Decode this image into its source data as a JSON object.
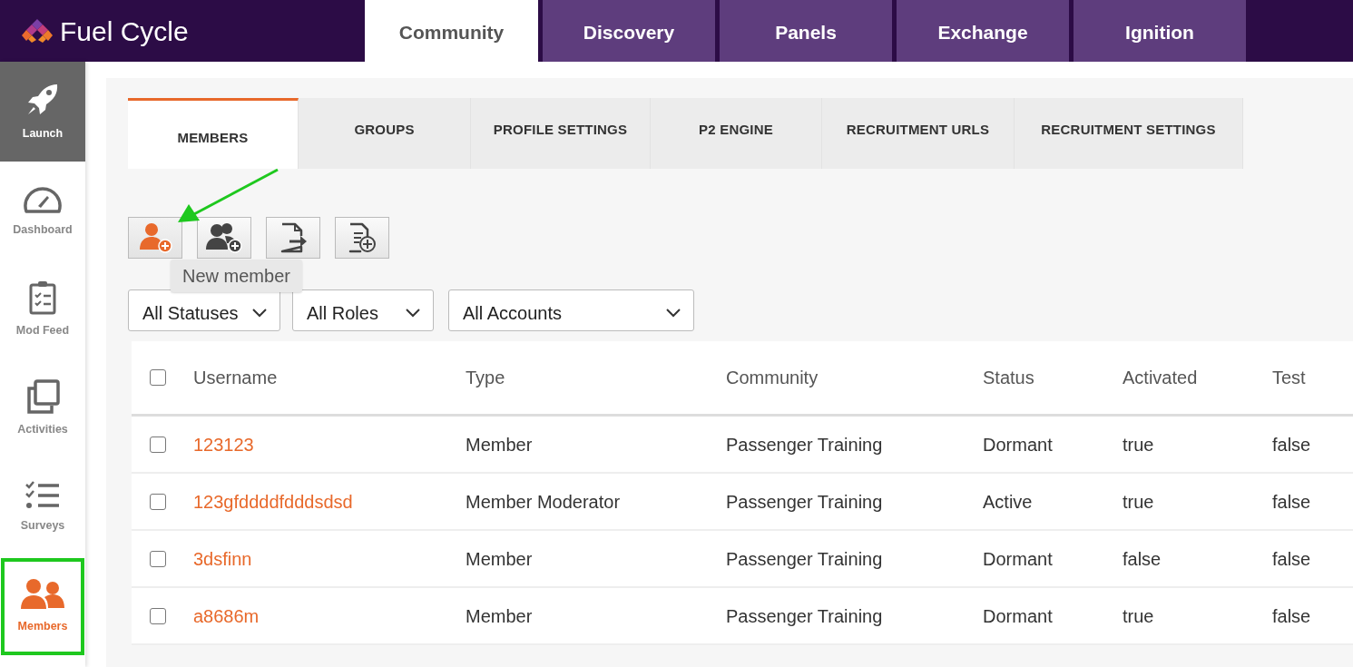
{
  "brand": {
    "name": "Fuel Cycle"
  },
  "top_tabs": [
    {
      "label": "Community",
      "selected": true
    },
    {
      "label": "Discovery",
      "selected": false
    },
    {
      "label": "Panels",
      "selected": false
    },
    {
      "label": "Exchange",
      "selected": false
    },
    {
      "label": "Ignition",
      "selected": false
    }
  ],
  "sidebar": {
    "items": [
      {
        "label": "Launch",
        "kind": "launch",
        "selected": false,
        "highlighted": false
      },
      {
        "label": "Dashboard",
        "kind": "dashboard",
        "selected": false,
        "highlighted": false
      },
      {
        "label": "Mod Feed",
        "kind": "modfeed",
        "selected": false,
        "highlighted": false
      },
      {
        "label": "Activities",
        "kind": "activities",
        "selected": false,
        "highlighted": false
      },
      {
        "label": "Surveys",
        "kind": "surveys",
        "selected": false,
        "highlighted": false
      },
      {
        "label": "Members",
        "kind": "members",
        "selected": true,
        "highlighted": true
      }
    ]
  },
  "sub_tabs": [
    {
      "label": "MEMBERS",
      "selected": true
    },
    {
      "label": "GROUPS",
      "selected": false
    },
    {
      "label": "PROFILE SETTINGS",
      "selected": false
    },
    {
      "label": "P2 ENGINE",
      "selected": false
    },
    {
      "label": "RECRUITMENT URLS",
      "selected": false
    },
    {
      "label": "RECRUITMENT SETTINGS",
      "selected": false
    }
  ],
  "toolbar": [
    {
      "kind": "new-member",
      "active": true
    },
    {
      "kind": "import-members",
      "active": false
    },
    {
      "kind": "export",
      "active": false
    },
    {
      "kind": "add-document",
      "active": false
    }
  ],
  "tooltip": "New member",
  "filters": [
    {
      "value": "All Statuses"
    },
    {
      "value": "All Roles"
    },
    {
      "value": "All Accounts"
    }
  ],
  "table": {
    "all_checked": false,
    "columns": [
      "Username",
      "Type",
      "Community",
      "Status",
      "Activated",
      "Test"
    ],
    "rows": [
      {
        "checked": false,
        "cells": [
          "123123",
          "Member",
          "Passenger Training",
          "Dormant",
          "true",
          "false"
        ]
      },
      {
        "checked": false,
        "cells": [
          "123gfddddfdddsdsd",
          "Member Moderator",
          "Passenger Training",
          "Active",
          "true",
          "false"
        ]
      },
      {
        "checked": false,
        "cells": [
          "3dsfinn",
          "Member",
          "Passenger Training",
          "Dormant",
          "false",
          "false"
        ]
      },
      {
        "checked": false,
        "cells": [
          "a8686m",
          "Member",
          "Passenger Training",
          "Dormant",
          "true",
          "false"
        ]
      }
    ]
  }
}
